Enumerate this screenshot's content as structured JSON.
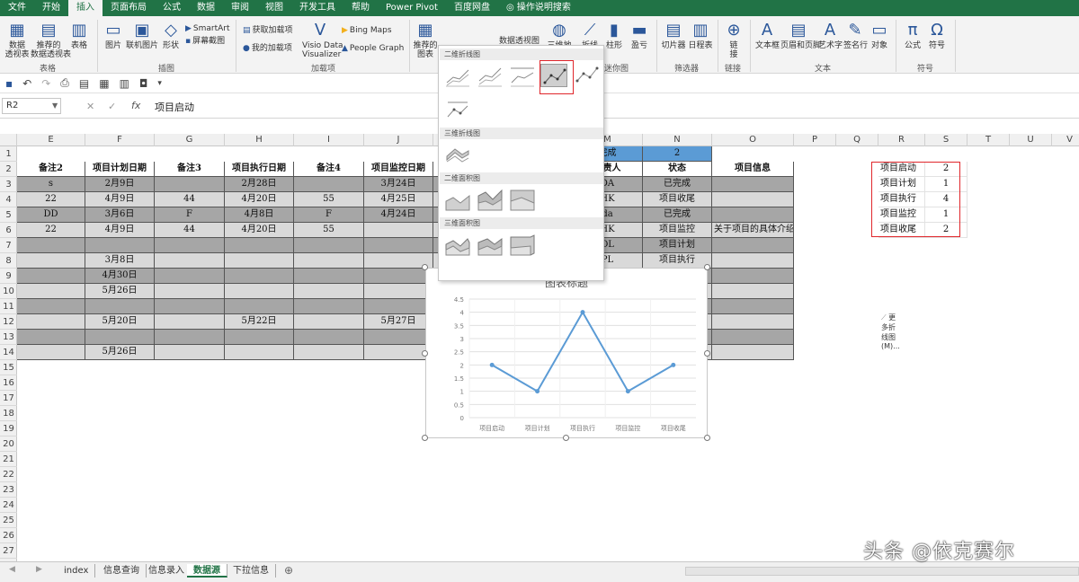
{
  "menu_tabs": [
    "文件",
    "开始",
    "插入",
    "页面布局",
    "公式",
    "数据",
    "审阅",
    "视图",
    "开发工具",
    "帮助",
    "Power Pivot",
    "百度网盘"
  ],
  "menu_active": "插入",
  "menu_search": "操作说明搜索",
  "ribbon": {
    "pivot_table": "数据\n透视表",
    "recommended_pivot": "推荐的\n数据透视表",
    "table": "表格",
    "group_tables": "表格",
    "picture": "图片",
    "online_picture": "联机图片",
    "shapes": "形状",
    "smartart": "SmartArt",
    "screenshot": "屏幕截图",
    "group_illustrations": "插图",
    "get_addins": "获取加载项",
    "my_addins": "我的加载项",
    "visio": "Visio Data\nVisualizer",
    "bing_maps": "Bing Maps",
    "people_graph": "People Graph",
    "group_addins": "加载项",
    "recommended_charts": "推荐的\n图表",
    "pivot_chart": "数据透视图",
    "map_3d": "三维地",
    "spark_line": "折线",
    "spark_column": "柱形",
    "spark_winloss": "盈亏",
    "group_sparklines": "迷你图",
    "slicer": "切片器",
    "timeline": "日程表",
    "group_filters": "筛选器",
    "link": "链\n接",
    "group_links": "链接",
    "textbox": "文本框",
    "header_footer": "页眉和页脚",
    "wordart": "艺术字",
    "signature": "签名行",
    "object": "对象",
    "group_text": "文本",
    "equation": "公式",
    "symbol": "符号",
    "group_symbols": "符号"
  },
  "formula_bar": {
    "name_box": "R2",
    "fx": "fx",
    "value": "项目启动"
  },
  "columns": [
    {
      "l": "E",
      "w": 76
    },
    {
      "l": "F",
      "w": 77
    },
    {
      "l": "G",
      "w": 78
    },
    {
      "l": "H",
      "w": 77
    },
    {
      "l": "I",
      "w": 78
    },
    {
      "l": "J",
      "w": 77
    },
    {
      "l": "K",
      "w": 78
    },
    {
      "l": "L",
      "w": 77
    },
    {
      "l": "M",
      "w": 78
    },
    {
      "l": "N",
      "w": 77
    },
    {
      "l": "O",
      "w": 91
    },
    {
      "l": "P",
      "w": 47
    },
    {
      "l": "Q",
      "w": 47
    },
    {
      "l": "R",
      "w": 52
    },
    {
      "l": "S",
      "w": 47
    },
    {
      "l": "T",
      "w": 47
    },
    {
      "l": "U",
      "w": 47
    },
    {
      "l": "V",
      "w": 40
    }
  ],
  "rows": [
    "1",
    "2",
    "3",
    "4",
    "5",
    "6",
    "7",
    "8",
    "9",
    "10",
    "11",
    "12",
    "13",
    "14",
    "15",
    "16",
    "17",
    "18",
    "19",
    "20",
    "21",
    "22",
    "23",
    "24",
    "25",
    "26",
    "27"
  ],
  "row1": {
    "m": "完成",
    "n": "2"
  },
  "headers": {
    "e": "备注2",
    "f": "项目计划日期",
    "g": "备注3",
    "h": "项目执行日期",
    "i": "备注4",
    "j": "项目监控日期",
    "m": "负责人",
    "n": "状态",
    "o": "项目信息"
  },
  "table_rows": [
    {
      "e": "s",
      "f": "2月9日",
      "g": "",
      "h": "2月28日",
      "i": "",
      "j": "3月24日",
      "m": "DA",
      "n": "已完成",
      "o": ""
    },
    {
      "e": "22",
      "f": "4月9日",
      "g": "44",
      "h": "4月20日",
      "i": "55",
      "j": "4月25日",
      "m": "HK",
      "n": "项目收尾",
      "o": ""
    },
    {
      "e": "DD",
      "f": "3月6日",
      "g": "F",
      "h": "4月8日",
      "i": "F",
      "j": "4月24日",
      "m": "da",
      "n": "已完成",
      "o": ""
    },
    {
      "e": "22",
      "f": "4月9日",
      "g": "44",
      "h": "4月20日",
      "i": "55",
      "j": "",
      "m": "HK",
      "n": "项目监控",
      "o": "关于项目的具体介绍"
    },
    {
      "e": "",
      "f": "",
      "g": "",
      "h": "",
      "i": "",
      "j": "",
      "m": "OL",
      "n": "项目计划",
      "o": ""
    },
    {
      "e": "",
      "f": "3月8日",
      "g": "",
      "h": "",
      "i": "",
      "j": "",
      "m": "PL",
      "n": "项目执行",
      "o": ""
    },
    {
      "e": "",
      "f": "4月30日",
      "g": "",
      "h": "",
      "i": "",
      "j": "",
      "m": "",
      "n": "",
      "o": ""
    },
    {
      "e": "",
      "f": "5月26日",
      "g": "",
      "h": "",
      "i": "",
      "j": "",
      "m": "",
      "n": "",
      "o": ""
    },
    {
      "e": "",
      "f": "",
      "g": "",
      "h": "",
      "i": "",
      "j": "",
      "m": "",
      "n": "",
      "o": ""
    },
    {
      "e": "",
      "f": "5月20日",
      "g": "",
      "h": "5月22日",
      "i": "",
      "j": "5月27日",
      "m": "",
      "n": "",
      "o": ""
    },
    {
      "e": "",
      "f": "",
      "g": "",
      "h": "",
      "i": "",
      "j": "",
      "m": "",
      "n": "",
      "o": ""
    },
    {
      "e": "",
      "f": "5月26日",
      "g": "",
      "h": "",
      "i": "",
      "j": "",
      "m": "",
      "n": "",
      "o": ""
    }
  ],
  "summary": [
    {
      "name": "项目启动",
      "count": "2"
    },
    {
      "name": "项目计划",
      "count": "1"
    },
    {
      "name": "项目执行",
      "count": "4"
    },
    {
      "name": "项目监控",
      "count": "1"
    },
    {
      "name": "项目收尾",
      "count": "2"
    }
  ],
  "gallery": {
    "section_2d_line": "二维折线图",
    "section_3d_line": "三维折线图",
    "section_2d_area": "二维面积图",
    "section_3d_area": "三维面积图",
    "more": "更多折线图(M)..."
  },
  "chart_data": {
    "type": "line",
    "title": "图表标题",
    "categories": [
      "项目启动",
      "项目计划",
      "项目执行",
      "项目监控",
      "项目收尾"
    ],
    "values": [
      2,
      1,
      4,
      1,
      2
    ],
    "ylim": [
      0,
      4.5
    ],
    "yticks": [
      "0",
      "0.5",
      "1",
      "1.5",
      "2",
      "2.5",
      "3",
      "3.5",
      "4",
      "4.5"
    ],
    "grid": true,
    "line_color": "#5b9bd5"
  },
  "sheet_tabs": [
    "index",
    "信息查询",
    "信息录入",
    "数据源",
    "下拉信息"
  ],
  "sheet_active": "数据源",
  "watermark": "头条 @依克赛尔",
  "colors": {
    "brand": "#217346",
    "header_blue": "#5b9bd5",
    "row_dark": "#a6a6a6",
    "row_light": "#d9d9d9",
    "highlight_red": "#e0262b"
  }
}
